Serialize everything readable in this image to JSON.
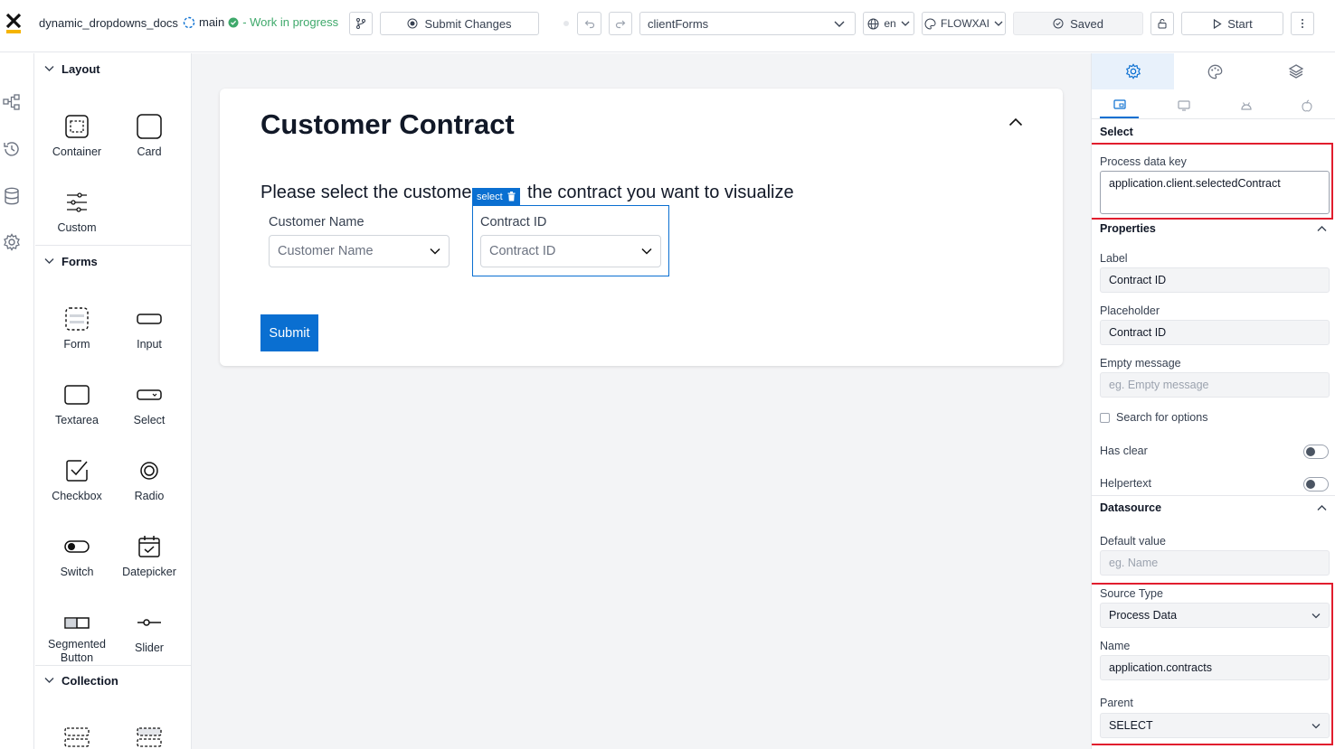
{
  "topbar": {
    "project_name": "dynamic_dropdowns_docs",
    "branch": "main",
    "branch_status": "- Work in progress",
    "submit_changes": "Submit Changes",
    "form_select": "clientForms",
    "language": "en",
    "theme": "FLOWXAI",
    "saved_label": "Saved",
    "start_label": "Start"
  },
  "palette": {
    "sections": {
      "layout": "Layout",
      "forms": "Forms",
      "collection": "Collection"
    },
    "layout_items": [
      "Container",
      "Card",
      "Custom"
    ],
    "forms_items": [
      "Form",
      "Input",
      "Textarea",
      "Select",
      "Checkbox",
      "Radio",
      "Switch",
      "Datepicker",
      "Segmented\nButton",
      "Slider"
    ]
  },
  "canvas": {
    "card_title": "Customer Contract",
    "instruction_left": "Please select the custome",
    "instruction_right": "the contract you want to visualize",
    "selection_tag": "select",
    "customer_label": "Customer Name",
    "customer_placeholder": "Customer Name",
    "contract_label": "Contract ID",
    "contract_placeholder": "Contract ID",
    "submit_label": "Submit"
  },
  "rightpanel": {
    "component_type": "Select",
    "process_data_key_label": "Process data key",
    "process_data_key_value": "application.client.selectedContract",
    "properties_header": "Properties",
    "label_label": "Label",
    "label_value": "Contract ID",
    "placeholder_label": "Placeholder",
    "placeholder_value": "Contract ID",
    "empty_message_label": "Empty message",
    "empty_message_placeholder": "eg. Empty message",
    "search_options_label": "Search for options",
    "has_clear_label": "Has clear",
    "helpertext_label": "Helpertext",
    "datasource_header": "Datasource",
    "default_value_label": "Default value",
    "default_value_placeholder": "eg. Name",
    "source_type_label": "Source Type",
    "source_type_value": "Process Data",
    "name_label": "Name",
    "name_value": "application.contracts",
    "parent_label": "Parent",
    "parent_value": "SELECT"
  },
  "colors": {
    "accent": "#0a6fd1",
    "highlight": "#e11d2e",
    "status": "#3fa96b"
  }
}
